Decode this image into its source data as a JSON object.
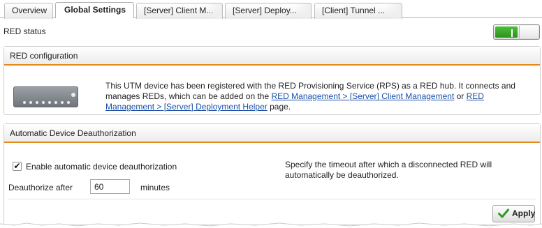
{
  "tabs": [
    {
      "label": "Overview",
      "active": false
    },
    {
      "label": "Global Settings",
      "active": true
    },
    {
      "label": "[Server] Client M...",
      "active": false
    },
    {
      "label": "[Server] Deploy...",
      "active": false
    },
    {
      "label": "[Client] Tunnel ...",
      "active": false
    }
  ],
  "status": {
    "label": "RED status",
    "toggle_on": true,
    "toggle_color": "#3aa92a"
  },
  "red_config": {
    "title": "RED configuration",
    "device_icon": "red-appliance-icon",
    "text_before": "This UTM device has been registered with the RED Provisioning Service (RPS) as a RED hub. It connects and manages REDs, which can be added on the ",
    "link1": "RED Management > [Server] Client Management",
    "text_mid": " or ",
    "link2": "RED Management > [Server] Deployment Helper",
    "text_after": " page."
  },
  "deauth": {
    "title": "Automatic Device Deauthorization",
    "checkbox_label": "Enable automatic device deauthorization",
    "checkbox_checked": true,
    "deauth_label": "Deauthorize after",
    "deauth_value": "60",
    "unit": "minutes",
    "hint": "Specify the timeout after which a disconnected RED will automatically be deauthorized.",
    "apply_label": "Apply",
    "apply_icon": "checkmark-icon"
  },
  "colors": {
    "accent": "#e38a18",
    "link": "#1b4fa8"
  }
}
